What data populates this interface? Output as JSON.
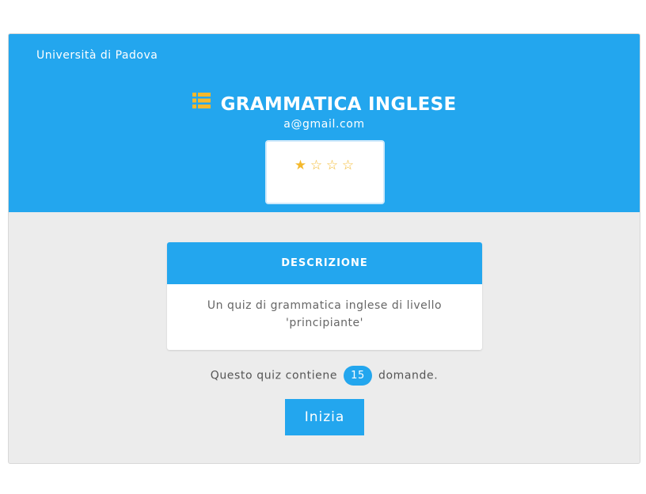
{
  "header": {
    "university": "Università di Padova",
    "title": "GRAMMATICA INGLESE",
    "email": "a@gmail.com",
    "icon": "list-icon",
    "accent_color": "#23a6ee",
    "icon_color": "#f4b82c"
  },
  "rating": {
    "filled": 1,
    "max": 4,
    "stars": [
      "★",
      "☆",
      "☆",
      "☆"
    ]
  },
  "description": {
    "heading": "DESCRIZIONE",
    "text": "Un quiz di grammatica inglese di livello 'principiante'"
  },
  "quiz_info": {
    "prefix": "Questo quiz contiene",
    "count": "15",
    "suffix": "domande."
  },
  "actions": {
    "start_label": "Inizia"
  }
}
